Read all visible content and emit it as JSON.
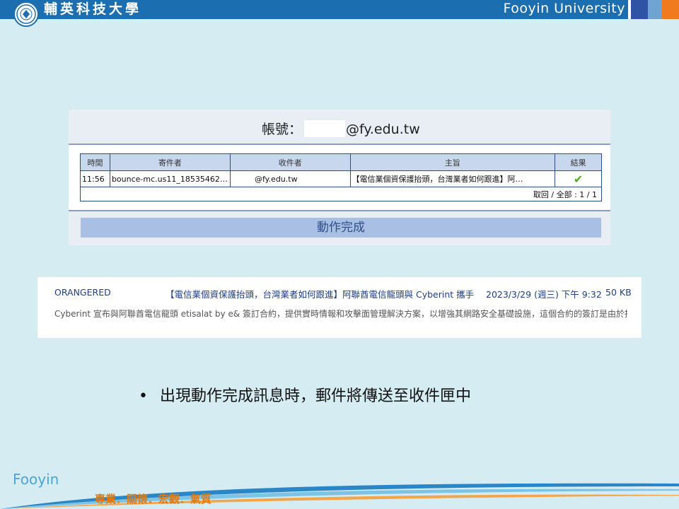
{
  "header": {
    "cn_name": "輔英科技大學",
    "en_name": "Fooyin University",
    "logo_icon": "university-seal-icon"
  },
  "account": {
    "label": "帳號：",
    "domain": "@fy.edu.tw"
  },
  "mail_table": {
    "headers": [
      "時間",
      "寄件者",
      "收件者",
      "主旨",
      "結果"
    ],
    "row": {
      "time": "11:56",
      "sender": "bounce-mc.us11_18535462…",
      "recipient_domain": "@fy.edu.tw",
      "subject": "【電信業個資保護抬頭，台灣業者如何跟進】阿…",
      "result_icon": "checkmark-icon"
    },
    "pager": "取回 / 全部 : 1 / 1"
  },
  "status": {
    "done": "動作完成"
  },
  "inbox_item": {
    "sender": "ORANGERED",
    "subject": "【電信業個資保護抬頭，台灣業者如何跟進】阿聯酋電信龍頭與 Cyberint 攜手 加強電信網路安全",
    "date": "2023/3/29 (週三) 下午 9:32",
    "size": "50 KB",
    "preview": "Cyberint 宣布與阿聯酋電信龍頭 etisalat by e& 簽訂合約，提供實時情報和攻擊面管理解決方案，以增強其網路安全基礎設施，這個合約的簽訂是由於採用過時的技術"
  },
  "bullet": {
    "text": "出現動作完成訊息時，郵件將傳送至收件匣中"
  },
  "footer": {
    "brand": "Fooyin",
    "motto": "專業．關懷．宏觀．氣質"
  },
  "colors": {
    "background": "#d6ecf3",
    "header": "#1b6fb0",
    "accent_orange": "#f07a1e",
    "done_bar": "#a9c0e4"
  }
}
